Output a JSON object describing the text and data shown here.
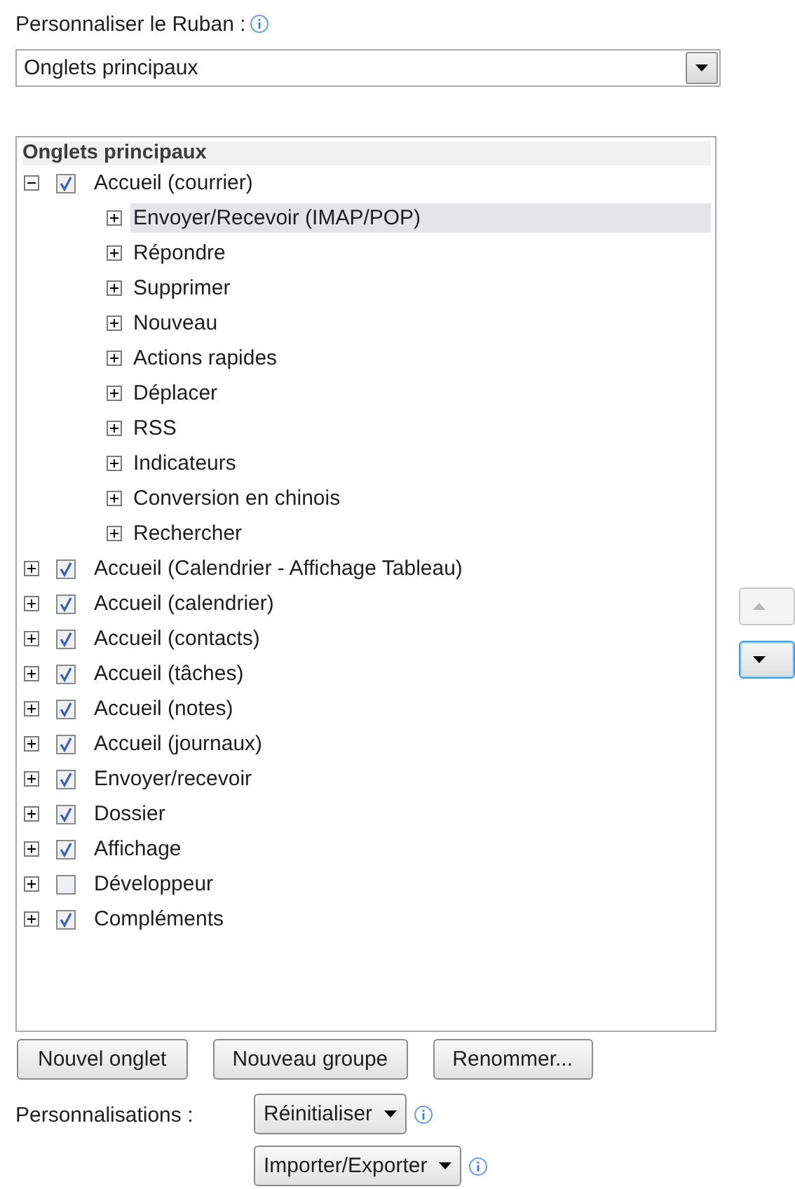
{
  "header": {
    "label": "Personnaliser le Ruban :"
  },
  "ribbon_select": {
    "value": "Onglets principaux"
  },
  "tree": {
    "heading": "Onglets principaux",
    "items": [
      {
        "kind": "tab",
        "label": "Accueil (courrier)",
        "checked": true,
        "expanded": true,
        "selected": false,
        "children": [
          {
            "kind": "group",
            "label": "Envoyer/Recevoir (IMAP/POP)",
            "expanded": false,
            "selected": true
          },
          {
            "kind": "group",
            "label": "Répondre",
            "expanded": false,
            "selected": false
          },
          {
            "kind": "group",
            "label": "Supprimer",
            "expanded": false,
            "selected": false
          },
          {
            "kind": "group",
            "label": "Nouveau",
            "expanded": false,
            "selected": false
          },
          {
            "kind": "group",
            "label": "Actions rapides",
            "expanded": false,
            "selected": false
          },
          {
            "kind": "group",
            "label": "Déplacer",
            "expanded": false,
            "selected": false
          },
          {
            "kind": "group",
            "label": "RSS",
            "expanded": false,
            "selected": false
          },
          {
            "kind": "group",
            "label": "Indicateurs",
            "expanded": false,
            "selected": false
          },
          {
            "kind": "group",
            "label": "Conversion en chinois",
            "expanded": false,
            "selected": false
          },
          {
            "kind": "group",
            "label": "Rechercher",
            "expanded": false,
            "selected": false
          }
        ]
      },
      {
        "kind": "tab",
        "label": "Accueil (Calendrier - Affichage Tableau)",
        "checked": true,
        "expanded": false,
        "selected": false
      },
      {
        "kind": "tab",
        "label": "Accueil (calendrier)",
        "checked": true,
        "expanded": false,
        "selected": false
      },
      {
        "kind": "tab",
        "label": "Accueil (contacts)",
        "checked": true,
        "expanded": false,
        "selected": false
      },
      {
        "kind": "tab",
        "label": "Accueil (tâches)",
        "checked": true,
        "expanded": false,
        "selected": false
      },
      {
        "kind": "tab",
        "label": "Accueil (notes)",
        "checked": true,
        "expanded": false,
        "selected": false
      },
      {
        "kind": "tab",
        "label": "Accueil (journaux)",
        "checked": true,
        "expanded": false,
        "selected": false
      },
      {
        "kind": "tab",
        "label": "Envoyer/recevoir",
        "checked": true,
        "expanded": false,
        "selected": false
      },
      {
        "kind": "tab",
        "label": "Dossier",
        "checked": true,
        "expanded": false,
        "selected": false
      },
      {
        "kind": "tab",
        "label": "Affichage",
        "checked": true,
        "expanded": false,
        "selected": false
      },
      {
        "kind": "tab",
        "label": "Développeur",
        "checked": false,
        "expanded": false,
        "selected": false
      },
      {
        "kind": "tab",
        "label": "Compléments",
        "checked": true,
        "expanded": false,
        "selected": false
      }
    ]
  },
  "move_buttons": [
    {
      "kind": "up",
      "disabled": true
    },
    {
      "kind": "down",
      "disabled": false
    }
  ],
  "buttons": [
    "Nouvel onglet",
    "Nouveau groupe",
    "Renommer..."
  ],
  "customizations": {
    "label": "Personnalisations :",
    "buttons": [
      "Réinitialiser",
      "Importer/Exporter"
    ]
  }
}
